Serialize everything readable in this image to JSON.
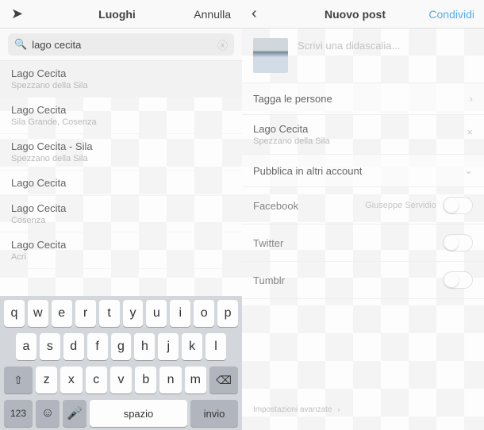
{
  "left": {
    "header": {
      "title": "Luoghi",
      "cancel": "Annulla"
    },
    "search": {
      "value": "lago cecita"
    },
    "results": [
      {
        "name": "Lago Cecita",
        "sub": "Spezzano della Sila"
      },
      {
        "name": "Lago Cecita",
        "sub": "Sila Grande, Cosenza"
      },
      {
        "name": "Lago Cecita - Sila",
        "sub": "Spezzano della Sila"
      },
      {
        "name": "Lago Cecita",
        "sub": ""
      },
      {
        "name": "Lago Cecita",
        "sub": "Cosenza"
      },
      {
        "name": "Lago Cecita",
        "sub": "Acri"
      }
    ],
    "keyboard": {
      "row1": [
        "q",
        "w",
        "e",
        "r",
        "t",
        "y",
        "u",
        "i",
        "o",
        "p"
      ],
      "row2": [
        "a",
        "s",
        "d",
        "f",
        "g",
        "h",
        "j",
        "k",
        "l"
      ],
      "row3": [
        "z",
        "x",
        "c",
        "v",
        "b",
        "n",
        "m"
      ],
      "num": "123",
      "space": "spazio",
      "return": "invio"
    }
  },
  "right": {
    "header": {
      "title": "Nuovo post",
      "share": "Condividi"
    },
    "caption_placeholder": "Scrivi una didascalia...",
    "tag": "Tagga le persone",
    "location": {
      "name": "Lago Cecita",
      "sub": "Spezzano della Sila"
    },
    "publish": "Pubblica in altri account",
    "shares": [
      {
        "label": "Facebook",
        "account": "Giuseppe Servidio"
      },
      {
        "label": "Twitter",
        "account": ""
      },
      {
        "label": "Tumblr",
        "account": ""
      }
    ],
    "advanced": "Impostazioni avanzate"
  }
}
